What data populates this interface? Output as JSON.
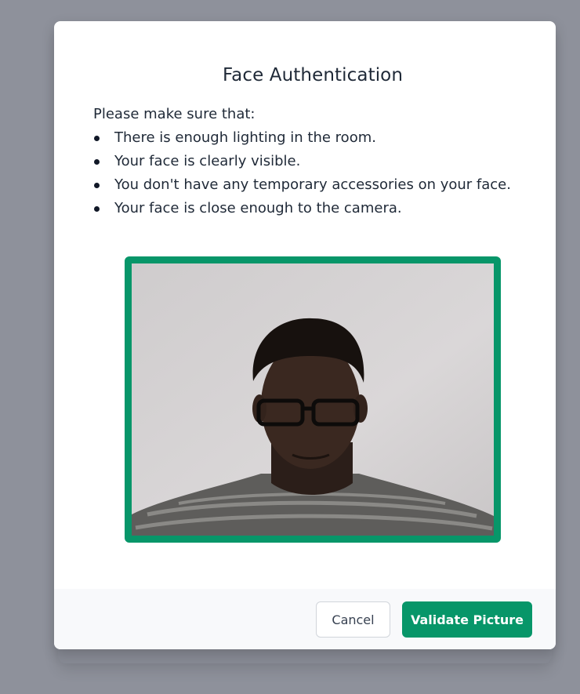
{
  "modal": {
    "title": "Face Authentication",
    "intro": "Please make sure that:",
    "checklist": [
      "There is enough lighting in the room.",
      "Your face is clearly visible.",
      "You don't have any temporary accessories on your face.",
      "Your face is close enough to the camera."
    ]
  },
  "camera": {
    "frame_color": "#079669"
  },
  "footer": {
    "cancel_label": "Cancel",
    "validate_label": "Validate Picture"
  },
  "colors": {
    "accent": "#079669",
    "backdrop": "#8e919b",
    "text": "#1f2937"
  }
}
